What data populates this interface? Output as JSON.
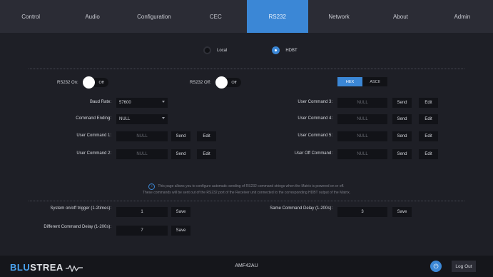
{
  "nav": {
    "tabs": [
      "Control",
      "Audio",
      "Configuration",
      "CEC",
      "RS232",
      "Network",
      "About",
      "Admin"
    ],
    "active": "RS232"
  },
  "source": {
    "local": "Local",
    "hdbt": "HDBT",
    "selected": "HDBT"
  },
  "rs232_on": {
    "label": "RS232 On:",
    "state": "Off"
  },
  "rs232_off": {
    "label": "RS232 Off:",
    "state": "Off"
  },
  "format": {
    "hex": "HEX",
    "ascii": "ASCII",
    "selected": "HEX"
  },
  "baud_rate": {
    "label": "Baud Rate:",
    "value": "57600"
  },
  "command_ending": {
    "label": "Command Ending:",
    "value": "NULL"
  },
  "user_commands": [
    {
      "label": "User Command 1:",
      "value": "NULL"
    },
    {
      "label": "User Command 2:",
      "value": "NULL"
    },
    {
      "label": "User Command 3:",
      "value": "NULL"
    },
    {
      "label": "User Command 4:",
      "value": "NULL"
    },
    {
      "label": "User Command 5:",
      "value": "NULL"
    },
    {
      "label": "User Off Command:",
      "value": "NULL"
    }
  ],
  "buttons": {
    "send": "Send",
    "edit": "Edit",
    "save": "Save"
  },
  "info": {
    "line1": "This page allows you to configure automatic sending of RS232 command strings when the Matrix is powered on or off.",
    "line2": "These commands will be sent out of the RS232 port of the Receiver unit connected to the corresponding HDBT output of the Matrix."
  },
  "trigger": {
    "label": "System on/off trigger (1-2times):",
    "value": "1"
  },
  "diff_delay": {
    "label": "Different Command Delay (1-200s):",
    "value": "7"
  },
  "same_delay": {
    "label": "Same Command Delay (1-200s):",
    "value": "3"
  },
  "footer": {
    "brand_accent": "BLU",
    "brand_rest": "STREA",
    "model": "AMF42AU",
    "logout": "Log Out"
  },
  "colors": {
    "accent": "#3b87d6",
    "background": "#1e1f26",
    "nav": "#2b2c35",
    "field": "#121318"
  },
  "icons": {
    "info": "info-icon",
    "power": "power-icon"
  }
}
